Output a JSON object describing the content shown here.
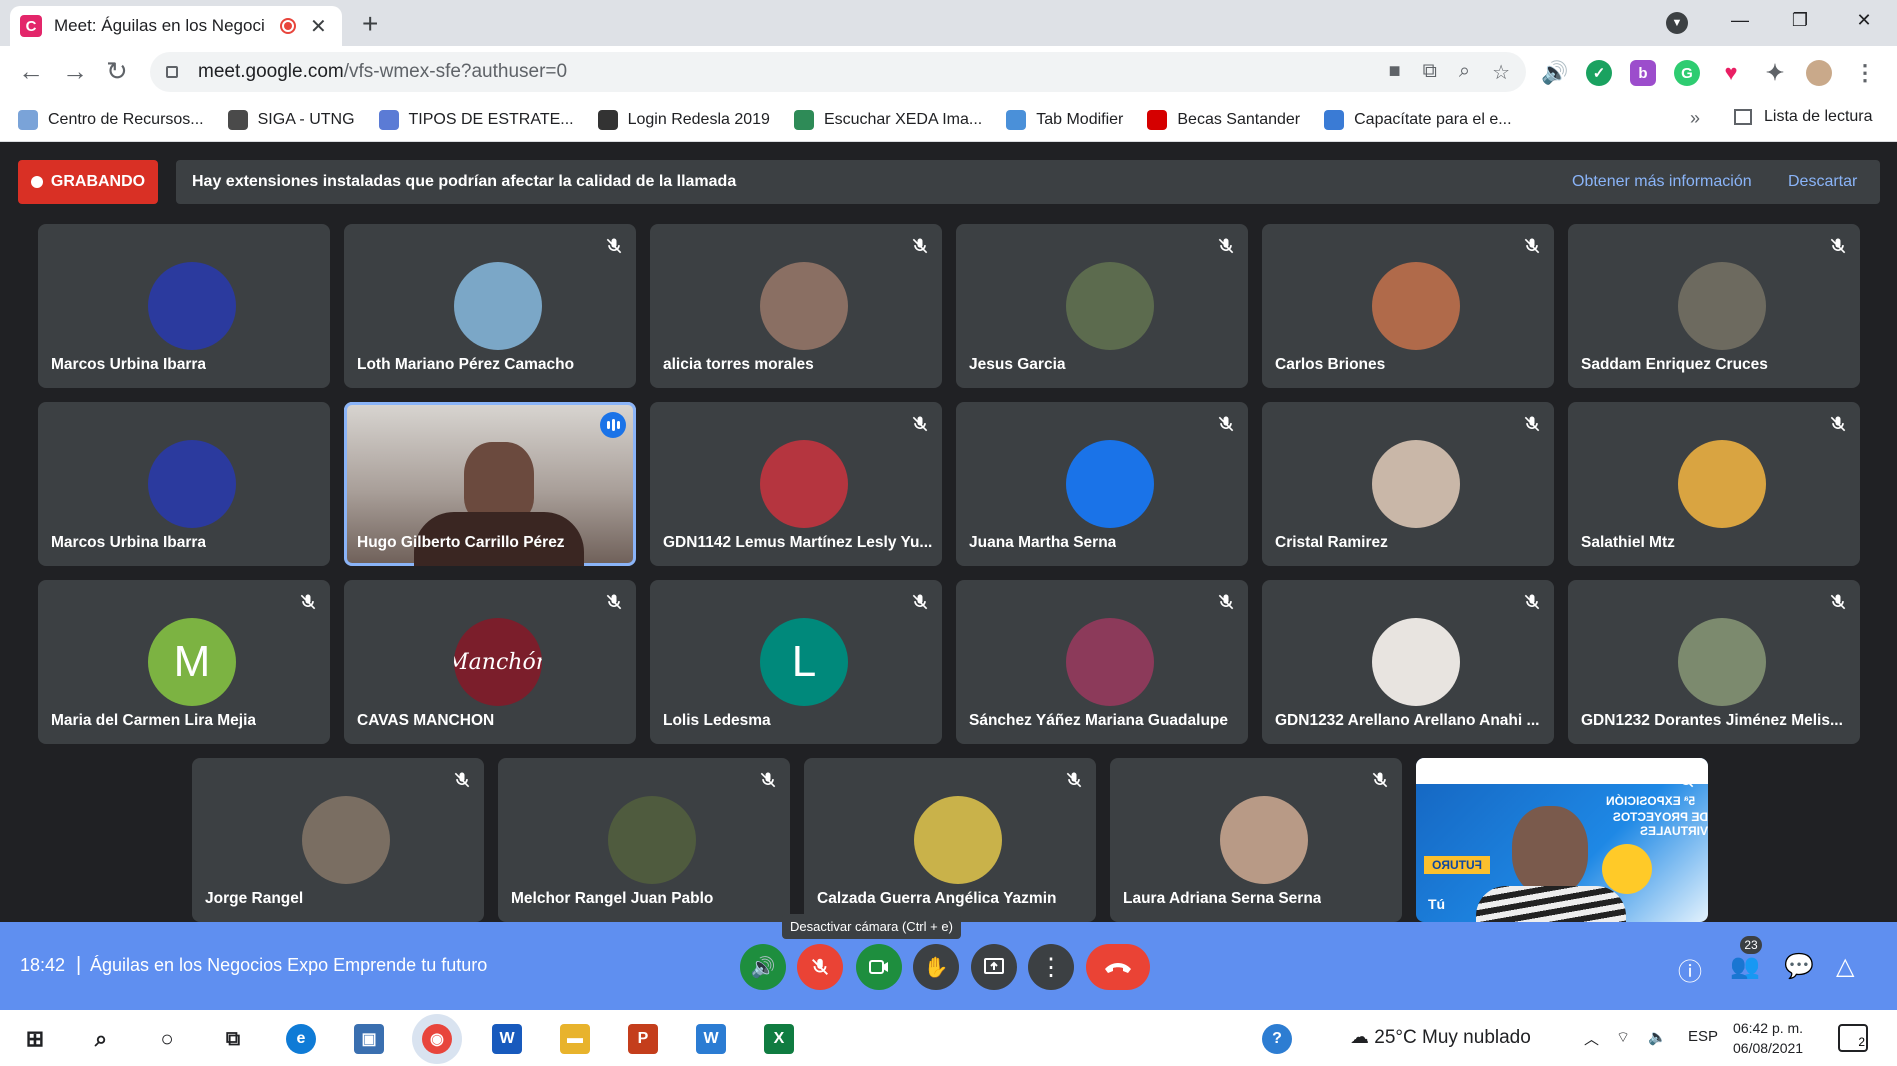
{
  "browser": {
    "tab_title": "Meet: Águilas en los Negoci",
    "url_host": "meet.google.com",
    "url_path": "/vfs-wmex-sfe?authuser=0",
    "bookmarks": [
      {
        "label": "Centro de Recursos...",
        "color": "#7aa3d8"
      },
      {
        "label": "SIGA - UTNG",
        "color": "#4a4a4a"
      },
      {
        "label": "TIPOS DE ESTRATE...",
        "color": "#5b7bd5"
      },
      {
        "label": "Login Redesla 2019",
        "color": "#333333"
      },
      {
        "label": "Escuchar XEDA Ima...",
        "color": "#2e8b57"
      },
      {
        "label": "Tab Modifier",
        "color": "#4a90d9"
      },
      {
        "label": "Becas Santander",
        "color": "#d50000"
      },
      {
        "label": "Capacítate para el e...",
        "color": "#3a7bd5"
      }
    ],
    "reading_list": "Lista de lectura"
  },
  "meet": {
    "recording_label": "GRABANDO",
    "banner_text": "Hay extensiones instaladas que podrían afectar la calidad de la llamada",
    "banner_more": "Obtener más información",
    "banner_dismiss": "Descartar",
    "participants": [
      {
        "name": "Marcos Urbina Ibarra",
        "muted": false,
        "avatar_color": "#2b3a9e"
      },
      {
        "name": "Loth Mariano Pérez Camacho",
        "muted": true,
        "avatar_color": "#7ba7c7"
      },
      {
        "name": "alicia torres morales",
        "muted": true,
        "avatar_color": "#8a6f63"
      },
      {
        "name": "Jesus Garcia",
        "muted": true,
        "avatar_color": "#5c6b4e"
      },
      {
        "name": "Carlos Briones",
        "muted": true,
        "avatar_color": "#b06a4a"
      },
      {
        "name": "Saddam Enriquez Cruces",
        "muted": true,
        "avatar_color": "#6d6a5f"
      },
      {
        "name": "Marcos Urbina Ibarra",
        "muted": false,
        "avatar_color": "#2b3a9e"
      },
      {
        "name": "Hugo Gilberto Carrillo Pérez",
        "muted": false,
        "avatar_color": "#8b7d78"
      },
      {
        "name": "GDN1142 Lemus Martínez Lesly Yu...",
        "muted": true,
        "avatar_color": "#b5353f"
      },
      {
        "name": "Juana Martha Serna",
        "muted": true,
        "avatar_color": "#1a73e8"
      },
      {
        "name": "Cristal Ramirez",
        "muted": true,
        "avatar_color": "#c9b7a8"
      },
      {
        "name": "Salathiel Mtz",
        "muted": true,
        "avatar_color": "#d9a441"
      },
      {
        "name": "Maria del Carmen Lira Mejia",
        "muted": true,
        "avatar_color": "#7cb342",
        "initial": "M"
      },
      {
        "name": "CAVAS MANCHON",
        "muted": true,
        "avatar_color": "#7b1e2b",
        "initial": "Manchón"
      },
      {
        "name": "Lolis Ledesma",
        "muted": true,
        "avatar_color": "#00897b",
        "initial": "L"
      },
      {
        "name": "Sánchez Yáñez Mariana Guadalupe",
        "muted": true,
        "avatar_color": "#8c3a5a"
      },
      {
        "name": "GDN1232 Arellano Arellano Anahi ...",
        "muted": true,
        "avatar_color": "#e8e4e0"
      },
      {
        "name": "GDN1232 Dorantes Jiménez Melis...",
        "muted": true,
        "avatar_color": "#7c8a6e"
      },
      {
        "name": "Jorge Rangel",
        "muted": true,
        "avatar_color": "#7a6e62"
      },
      {
        "name": "Melchor Rangel Juan Pablo",
        "muted": true,
        "avatar_color": "#4f5b3e"
      },
      {
        "name": "Calzada Guerra Angélica Yazmin",
        "muted": true,
        "avatar_color": "#c9b24a"
      },
      {
        "name": "Laura Adriana Serna Serna",
        "muted": true,
        "avatar_color": "#b89a86"
      }
    ],
    "self_label": "Tú",
    "self_poster": {
      "line1": "5ª EXPOSICIÓN",
      "line2": "DE PROYECTOS VIRTUALES",
      "ribbon": "FUTURO"
    }
  },
  "bottombar": {
    "time": "18:42",
    "meeting_title": "Águilas en los Negocios Expo Emprende tu futuro",
    "tooltip": "Desactivar cámara (Ctrl + e)",
    "people_count": "23"
  },
  "taskbar": {
    "weather": "25°C  Muy nublado",
    "lang": "ESP",
    "time": "06:42 p. m.",
    "date": "06/08/2021",
    "notifications": "2"
  }
}
